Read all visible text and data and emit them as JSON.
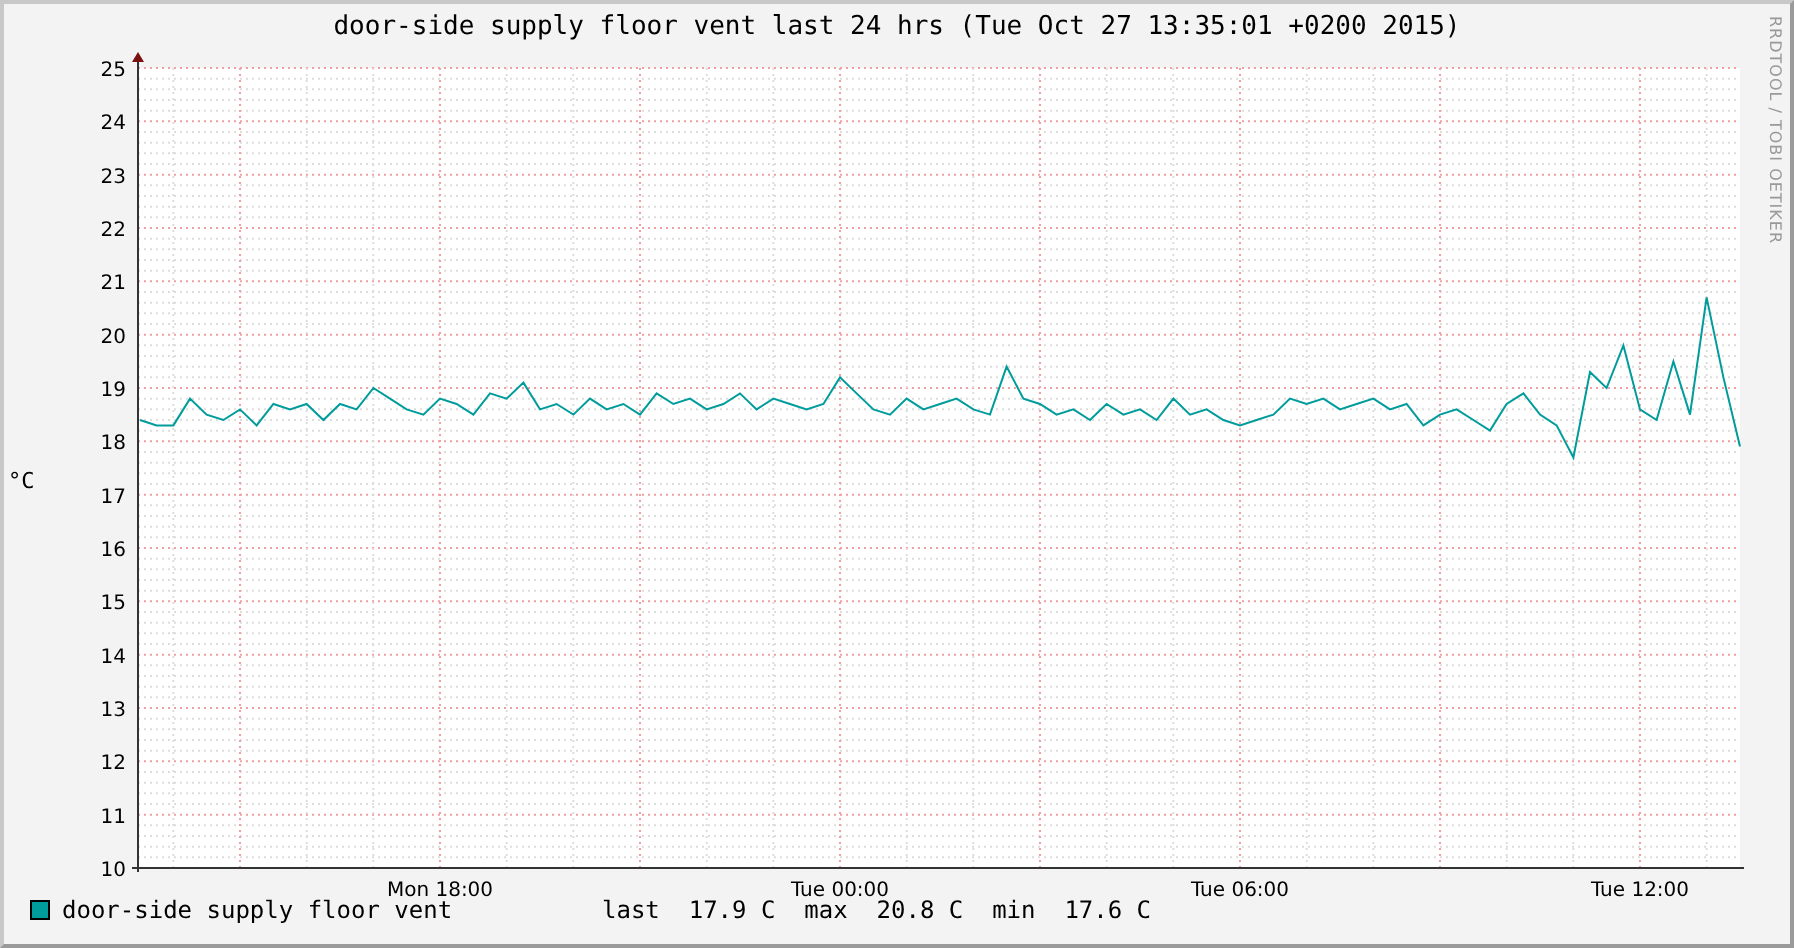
{
  "title": "door-side supply floor vent last 24 hrs (Tue Oct 27 13:35:01 +0200 2015)",
  "credit": "RRDTOOL / TOBI OETIKER",
  "chart_data": {
    "type": "line",
    "ylabel": "°C",
    "categories": [
      null,
      null,
      null,
      null,
      null,
      null,
      null,
      null,
      null,
      null,
      null,
      null,
      null,
      null,
      null,
      null,
      null,
      null,
      "Mon 18:00",
      null,
      null,
      null,
      null,
      null,
      null,
      null,
      null,
      null,
      null,
      null,
      null,
      null,
      null,
      null,
      null,
      null,
      null,
      null,
      null,
      null,
      null,
      null,
      "Tue 00:00",
      null,
      null,
      null,
      null,
      null,
      null,
      null,
      null,
      null,
      null,
      null,
      null,
      null,
      null,
      null,
      null,
      null,
      null,
      null,
      null,
      null,
      null,
      null,
      "Tue 06:00",
      null,
      null,
      null,
      null,
      null,
      null,
      null,
      null,
      null,
      null,
      null,
      null,
      null,
      null,
      null,
      null,
      null,
      null,
      null,
      null,
      null,
      null,
      null,
      "Tue 12:00",
      null,
      null,
      null,
      null,
      null,
      null
    ],
    "series": [
      {
        "name": "door-side supply floor vent",
        "color": "#009c9c",
        "values": [
          18.4,
          18.3,
          18.3,
          18.8,
          18.5,
          18.4,
          18.6,
          18.3,
          18.7,
          18.6,
          18.7,
          18.4,
          18.7,
          18.6,
          19.0,
          18.8,
          18.6,
          18.5,
          18.8,
          18.7,
          18.5,
          18.9,
          18.8,
          19.1,
          18.6,
          18.7,
          18.5,
          18.8,
          18.6,
          18.7,
          18.5,
          18.9,
          18.7,
          18.8,
          18.6,
          18.7,
          18.9,
          18.6,
          18.8,
          18.7,
          18.6,
          18.7,
          19.2,
          18.9,
          18.6,
          18.5,
          18.8,
          18.6,
          18.7,
          18.8,
          18.6,
          18.5,
          19.4,
          18.8,
          18.7,
          18.5,
          18.6,
          18.4,
          18.7,
          18.5,
          18.6,
          18.4,
          18.8,
          18.5,
          18.6,
          18.4,
          18.3,
          18.4,
          18.5,
          18.8,
          18.7,
          18.8,
          18.6,
          18.7,
          18.8,
          18.6,
          18.7,
          18.3,
          18.5,
          18.6,
          18.4,
          18.2,
          18.7,
          18.9,
          18.5,
          18.3,
          17.7,
          19.3,
          19.0,
          19.8,
          18.6,
          18.4,
          19.5,
          18.5,
          20.7,
          19.2,
          17.9
        ]
      }
    ],
    "grid": true,
    "ylim": [
      10,
      25
    ],
    "yticks": [
      10,
      11,
      12,
      13,
      14,
      15,
      16,
      17,
      18,
      19,
      20,
      21,
      22,
      23,
      24,
      25
    ]
  },
  "legend": {
    "stats": "last  17.9 C  max  20.8 C  min  17.6 C"
  }
}
